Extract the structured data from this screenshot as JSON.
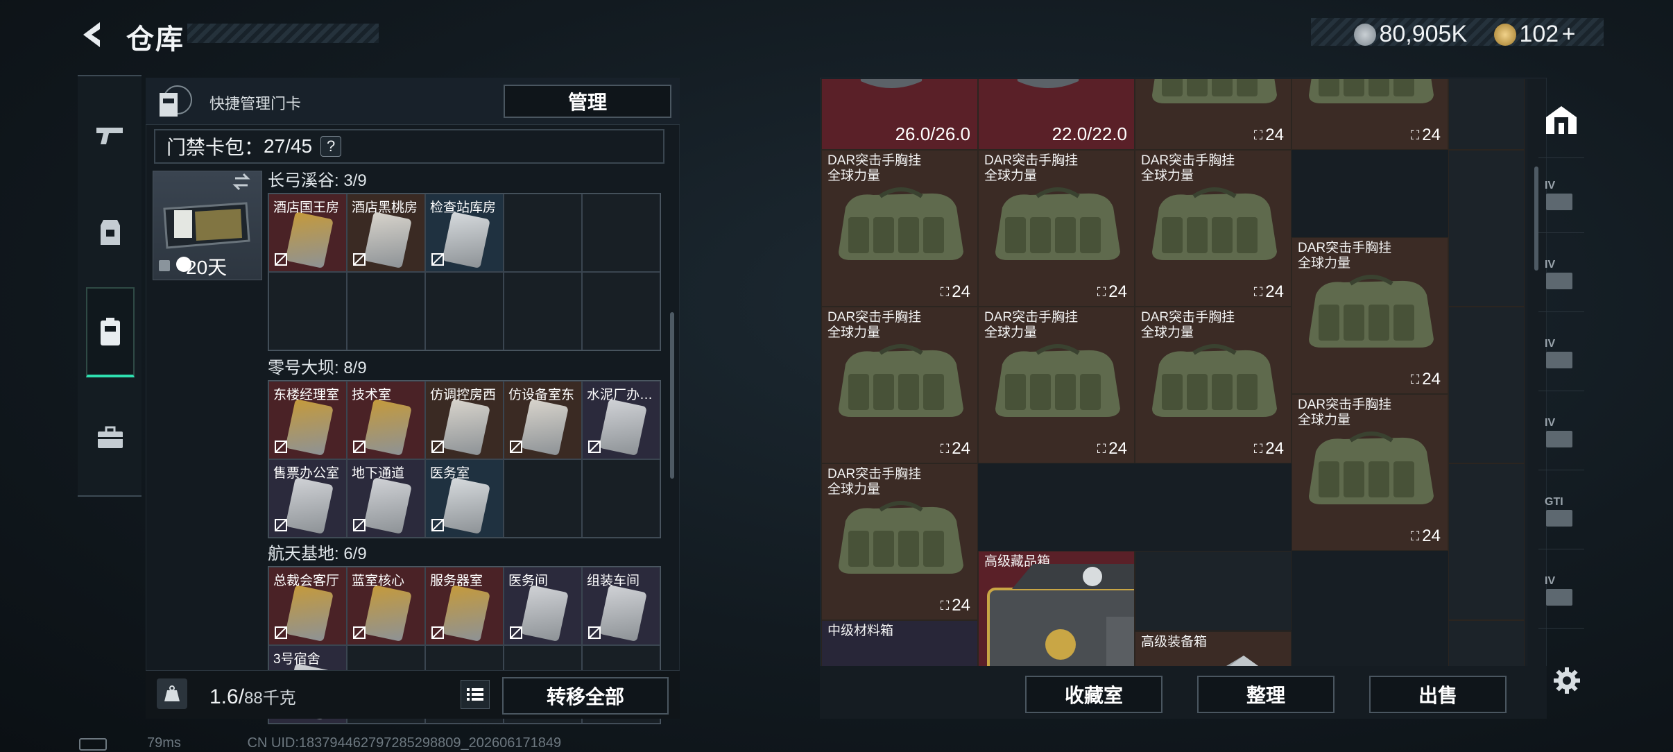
{
  "header": {
    "title": "仓库",
    "currency1": "80,905K",
    "currency2": "102",
    "currency2_plus": "+"
  },
  "left_nav": {
    "items": [
      "weapon",
      "armor",
      "keycard",
      "case"
    ]
  },
  "keycards": {
    "quick_manage_label": "快捷管理门卡",
    "manage_button": "管理",
    "card_pack_label": "门禁卡包：",
    "card_pack_count": "27/45",
    "help": "?",
    "featured_days": "20天",
    "sections": [
      {
        "title": "长弓溪谷: 3/9",
        "cells": [
          {
            "label": "酒店国王房",
            "color": "red"
          },
          {
            "label": "酒店黑桃房",
            "color": "brown"
          },
          {
            "label": "检查站库房",
            "color": "blue"
          }
        ]
      },
      {
        "title": "零号大坝: 8/9",
        "cells": [
          {
            "label": "东楼经理室",
            "color": "red"
          },
          {
            "label": "技术室",
            "color": "red"
          },
          {
            "label": "仿调控房西",
            "color": "brown"
          },
          {
            "label": "仿设备室东",
            "color": "brown"
          },
          {
            "label": "水泥厂办…",
            "color": "purple"
          },
          {
            "label": "售票办公室",
            "color": "purple"
          },
          {
            "label": "地下通道",
            "color": "purple"
          },
          {
            "label": "医务室",
            "color": "blue"
          }
        ]
      },
      {
        "title": "航天基地: 6/9",
        "cells": [
          {
            "label": "总裁会客厅",
            "color": "red"
          },
          {
            "label": "蓝室核心",
            "color": "red"
          },
          {
            "label": "服务器室",
            "color": "red"
          },
          {
            "label": "医务间",
            "color": "purple"
          },
          {
            "label": "组装车间",
            "color": "purple"
          },
          {
            "label": "3号宿舍",
            "color": "purple"
          }
        ]
      }
    ],
    "weight_value": "1.6/",
    "weight_max": "88千克",
    "transfer_all": "转移全部"
  },
  "storage": {
    "items": [
      {
        "name": "",
        "line2": "",
        "durability": "26.0/26.0",
        "count": "",
        "color": "red"
      },
      {
        "name": "",
        "line2": "",
        "durability": "22.0/22.0",
        "count": "",
        "color": "red"
      },
      {
        "name": "",
        "line2": "",
        "durability": "",
        "count": "24",
        "color": "brown"
      },
      {
        "name": "DAR突击手胸挂",
        "line2": "全球力量",
        "durability": "",
        "count": "24",
        "color": "brown"
      },
      {
        "name": "DAR突击手胸挂",
        "line2": "全球力量",
        "durability": "",
        "count": "24",
        "color": "brown"
      },
      {
        "name": "DAR突击手胸挂",
        "line2": "全球力量",
        "durability": "",
        "count": "24",
        "color": "brown"
      },
      {
        "name": "DAR突击手胸挂",
        "line2": "全球力量",
        "durability": "",
        "count": "24",
        "color": "brown"
      },
      {
        "name": "DAR突击手胸挂",
        "line2": "全球力量",
        "durability": "",
        "count": "24",
        "color": "brown"
      },
      {
        "name": "DAR突击手胸挂",
        "line2": "全球力量",
        "durability": "",
        "count": "24",
        "color": "brown"
      },
      {
        "name": "DAR突击手胸挂",
        "line2": "全球力量",
        "durability": "",
        "count": "24",
        "color": "brown"
      },
      {
        "name": "DAR突击手胸挂",
        "line2": "全球力量",
        "durability": "",
        "count": "24",
        "color": "brown"
      },
      {
        "name": "DAR突击手胸挂",
        "line2": "全球力量",
        "durability": "",
        "count": "24",
        "color": "brown"
      },
      {
        "name": "DAR突击手胸挂",
        "line2": "全球力量",
        "durability": "",
        "count": "24",
        "color": "brown"
      }
    ],
    "high_box": "高级藏品箱",
    "equip_box": "高级装备箱",
    "mid_material_box": "中级材料箱",
    "buttons": {
      "collection": "收藏室",
      "sort": "整理",
      "sell": "出售"
    }
  },
  "right_nav": {
    "labels": [
      "IV",
      "IV",
      "IV",
      "IV",
      "GTI",
      "IV"
    ]
  },
  "status": {
    "ping": "79ms",
    "uid": "CN UID:18379446279728529880​9_202606171849"
  }
}
